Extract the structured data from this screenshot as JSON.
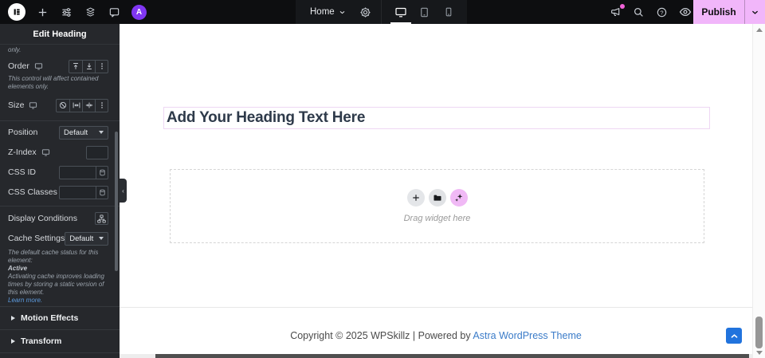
{
  "topbar": {
    "home_label": "Home",
    "publish_label": "Publish",
    "avatar_letter": "A",
    "icons_left": [
      "elementor-logo",
      "add-element",
      "site-settings-sliders",
      "structure-layers",
      "notes-comment",
      "user-avatar"
    ],
    "icons_center": [
      "page-settings-gear",
      "device-desktop",
      "device-tablet",
      "device-mobile"
    ],
    "icons_right": [
      "whats-new-megaphone",
      "search",
      "help",
      "preview-eye"
    ],
    "active_device": "desktop"
  },
  "panel": {
    "title": "Edit Heading",
    "clipped_text": "only.",
    "order": {
      "label": "Order",
      "hint": "This control will affect contained elements only."
    },
    "size": {
      "label": "Size"
    },
    "position": {
      "label": "Position",
      "value": "Default"
    },
    "z_index": {
      "label": "Z-Index"
    },
    "css_id": {
      "label": "CSS ID"
    },
    "css_classes": {
      "label": "CSS Classes"
    },
    "display_conditions": {
      "label": "Display Conditions"
    },
    "cache": {
      "label": "Cache Settings",
      "value": "Default",
      "hint_intro": "The default cache status for this element:",
      "status": "Active",
      "hint_body": "Activating cache improves loading times by storing a static version of this element.",
      "learn_more": "Learn more."
    },
    "sections": [
      {
        "label": "Motion Effects"
      },
      {
        "label": "Transform"
      }
    ],
    "icons": [
      "responsive-monitor",
      "align-start",
      "align-end",
      "options-ellipsis",
      "ban",
      "fit-width",
      "shrink-width",
      "dynamic-tags",
      "display-conditions-sitemap",
      "collapse-panel-chevron"
    ]
  },
  "canvas": {
    "heading_text": "Add Your Heading Text Here",
    "drag_hint": "Drag widget here",
    "widget_buttons": [
      "add-widget-plus",
      "templates-folder",
      "ai-sparkles"
    ],
    "footer_text": "Copyright © 2025 WPSkillz | Powered by ",
    "footer_link": "Astra WordPress Theme"
  },
  "colors": {
    "topbar_bg": "#0d0e10",
    "panel_bg": "#26282c",
    "publish_pink": "#f1b6fa",
    "avatar_purple": "#8036f2",
    "ai_button_pink": "#f0b9f5",
    "notification_dot": "#f062d8",
    "selection_outline": "#eed7f3",
    "heading_color": "#2e3a4a",
    "learn_more_blue": "#5d9bde",
    "footer_link_blue": "#3a7bc8",
    "scrolltop_blue": "#2173dd"
  }
}
